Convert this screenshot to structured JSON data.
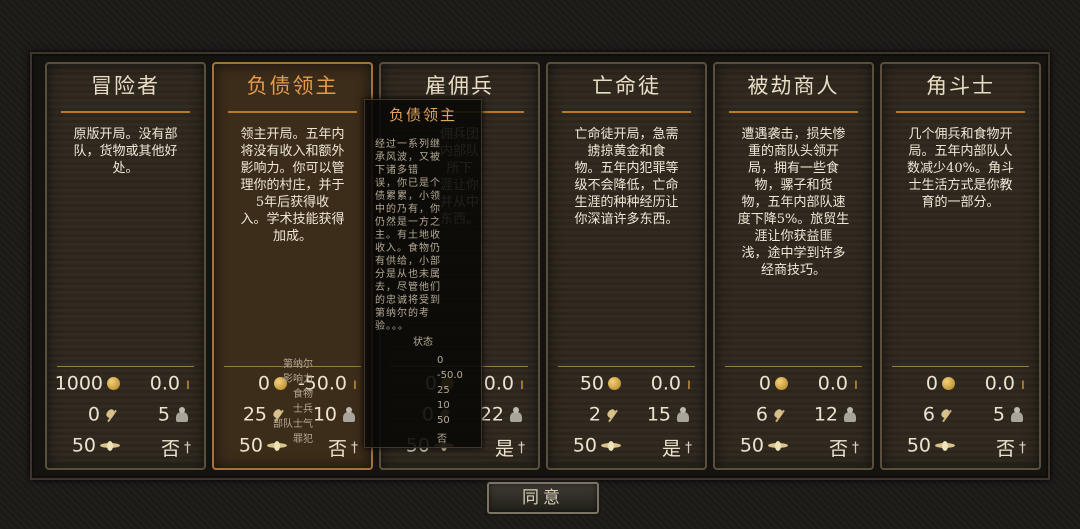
{
  "cards": [
    {
      "title": "冒险者",
      "desc": "原版开局。没有部\n队，货物或其他好\n处。",
      "gold": "1000",
      "influence": "0.0",
      "food": "0",
      "troops": "5",
      "skill": "50",
      "crime": "否"
    },
    {
      "title": "负债领主",
      "desc": "领主开局。五年内\n将没有收入和额外\n影响力。你可以管\n理你的村庄，并于\n5年后获得收\n入。学术技能获得\n加成。",
      "gold": "0",
      "influence": "-50.0",
      "food": "25",
      "troops": "10",
      "skill": "50",
      "crime": "否"
    },
    {
      "title": "雇佣兵",
      "desc": "佣兵团\n内部队\n所下\n涯让你\n并从中\n东西。",
      "gold": "0",
      "influence": "0.0",
      "food": "0",
      "troops": "22",
      "skill": "50",
      "crime": "是"
    },
    {
      "title": "亡命徒",
      "desc": "亡命徒开局，急需\n掳掠黄金和食\n物。五年内犯罪等\n级不会降低，亡命\n生涯的种种经历让\n你深谙许多东西。",
      "gold": "50",
      "influence": "0.0",
      "food": "2",
      "troops": "15",
      "skill": "50",
      "crime": "是"
    },
    {
      "title": "被劫商人",
      "desc": "遭遇袭击，损失惨\n重的商队头领开\n局，拥有一些食\n物，骡子和货\n物，五年内部队速\n度下降5%。旅贸生\n涯让你获益匪\n浅，途中学到许多\n经商技巧。",
      "gold": "0",
      "influence": "0.0",
      "food": "6",
      "troops": "12",
      "skill": "50",
      "crime": "否"
    },
    {
      "title": "角斗士",
      "desc": "几个佣兵和食物开\n局。五年内部队人\n数减少40%。角斗\n士生活方式是你教\n育的一部分。",
      "gold": "0",
      "influence": "0.0",
      "food": "6",
      "troops": "5",
      "skill": "50",
      "crime": "否"
    }
  ],
  "tooltip": {
    "title": "负债领主",
    "body": "经过一系列继\n承风波，又被\n下诸多错\n误，你已是个\n债累累，小领\n中的乃有，你\n仍然是一方之\n主。有土地收\n收入。食物仍\n有供给，小部\n分是从也未属\n去，尽管他们\n的忠诚将受到\n第纳尔的考\n验。。。",
    "status_label": "状态",
    "stats": [
      {
        "k": "第纳尔",
        "v": "0"
      },
      {
        "k": "影响力",
        "v": "-50.0"
      },
      {
        "k": "食物",
        "v": "25"
      },
      {
        "k": "士兵",
        "v": "10"
      },
      {
        "k": "部队士气",
        "v": "50"
      },
      {
        "k": "罪犯",
        "v": "否"
      }
    ]
  },
  "agree_label": "同意"
}
